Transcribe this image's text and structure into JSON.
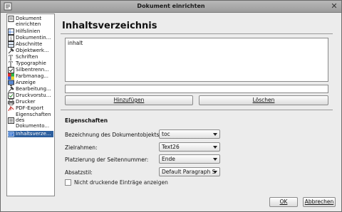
{
  "window": {
    "title": "Dokument einrichten"
  },
  "sidebar": {
    "items": [
      {
        "label": "Dokument einrichten",
        "icon": "document-setup-icon"
      },
      {
        "label": "Hilfslinien",
        "icon": "guides-icon"
      },
      {
        "label": "Dokumentin...",
        "icon": "document-info-icon"
      },
      {
        "label": "Abschnitte",
        "icon": "sections-icon"
      },
      {
        "label": "Objektwerk...",
        "icon": "tools-icon"
      },
      {
        "label": "Schriften",
        "icon": "fonts-icon"
      },
      {
        "label": "Typographie",
        "icon": "typography-icon"
      },
      {
        "label": "Silbentrenn...",
        "icon": "hyphenation-icon"
      },
      {
        "label": "Farbmanag...",
        "icon": "color-management-icon"
      },
      {
        "label": "Anzeige",
        "icon": "display-icon"
      },
      {
        "label": "Bearbeitung...",
        "icon": "editing-icon"
      },
      {
        "label": "Druckvorstu...",
        "icon": "preflight-icon"
      },
      {
        "label": "Drucker",
        "icon": "printer-icon"
      },
      {
        "label": "PDF-Export",
        "icon": "pdf-export-icon"
      },
      {
        "label": "Eigenschaften des Dokumento...",
        "icon": "document-properties-icon"
      },
      {
        "label": "Inhaltsverze...",
        "icon": "toc-icon"
      }
    ]
  },
  "main": {
    "title": "Inhaltsverzeichnis",
    "list_items": [
      "inhalt"
    ],
    "name_field_value": "",
    "add_button": "Hinzufügen",
    "delete_button": "Löschen",
    "properties_title": "Eigenschaften",
    "fields": [
      {
        "label": "Bezeichnung des Dokumentobjekts:",
        "value": "toc"
      },
      {
        "label": "Zielrahmen:",
        "value": "Text26"
      },
      {
        "label": "Platzierung der Seitennummer:",
        "value": "Ende"
      },
      {
        "label": "Absatzstil:",
        "value": "Default Paragraph S"
      }
    ],
    "checkbox_label": "Nicht druckende Einträge anzeigen"
  },
  "footer": {
    "ok": "OK",
    "cancel": "Abbrechen"
  },
  "colors": {
    "selection": "#2d5f9e",
    "titlebar": "#a8a8a8",
    "background": "#ececec"
  }
}
